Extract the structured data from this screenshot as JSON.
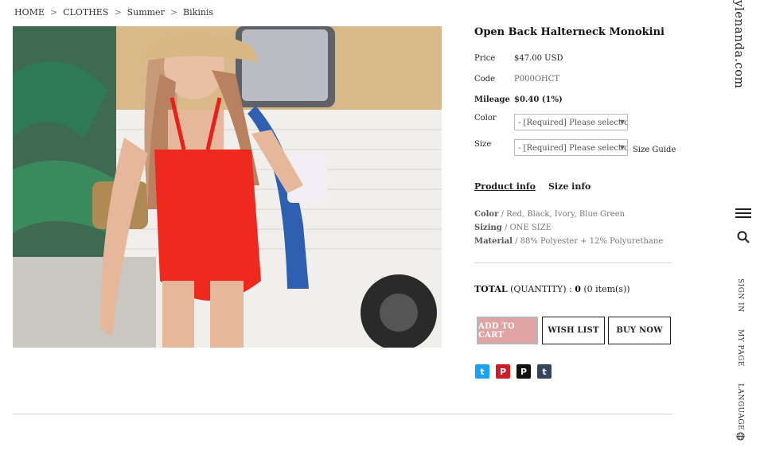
{
  "breadcrumb": [
    "HOME",
    "CLOTHES",
    "Summer",
    "Bikinis"
  ],
  "product": {
    "title": "Open Back Halterneck Monokini",
    "price_label": "Price",
    "price": "$47.00 USD",
    "code_label": "Code",
    "code": "P000OHCT",
    "mileage_label": "Mileage",
    "mileage": "$0.40 (1%)",
    "color_label": "Color",
    "color_placeholder": "- [Required] Please select opt",
    "size_label": "Size",
    "size_placeholder": "- [Required] Please select opt",
    "size_guide": "Size Guide"
  },
  "tabs": {
    "info": "Product info",
    "size": "Size info"
  },
  "specs": {
    "color_k": "Color",
    "color_v": "/ Red, Black, Ivory, Blue Green",
    "sizing_k": "Sizing",
    "sizing_v": "/ ONE SIZE",
    "material_k": "Material",
    "material_v": "/ 88% Polyester + 12% Polyurethane"
  },
  "total": {
    "label": "TOTAL",
    "qty_label": "(QUANTITY) :",
    "qty": "0",
    "items": "(0 item(s))"
  },
  "buttons": {
    "cart": "ADD TO CART",
    "wish": "WISH LIST",
    "buy": "BUY NOW"
  },
  "social": [
    {
      "name": "twitter-icon",
      "glyph": "t",
      "color": "#1da1f2"
    },
    {
      "name": "pinterest-icon",
      "glyph": "P",
      "color": "#cb2027"
    },
    {
      "name": "polyvore-icon",
      "glyph": "P",
      "color": "#111111"
    },
    {
      "name": "tumblr-icon",
      "glyph": "t",
      "color": "#35465c"
    }
  ],
  "sidebar": {
    "brand": "ylenanda.com",
    "sign_in": "SIGN IN",
    "my_page": "MY PAGE",
    "language": "LANGUAGE"
  },
  "colors": {
    "accent": "#dfa3a3"
  }
}
